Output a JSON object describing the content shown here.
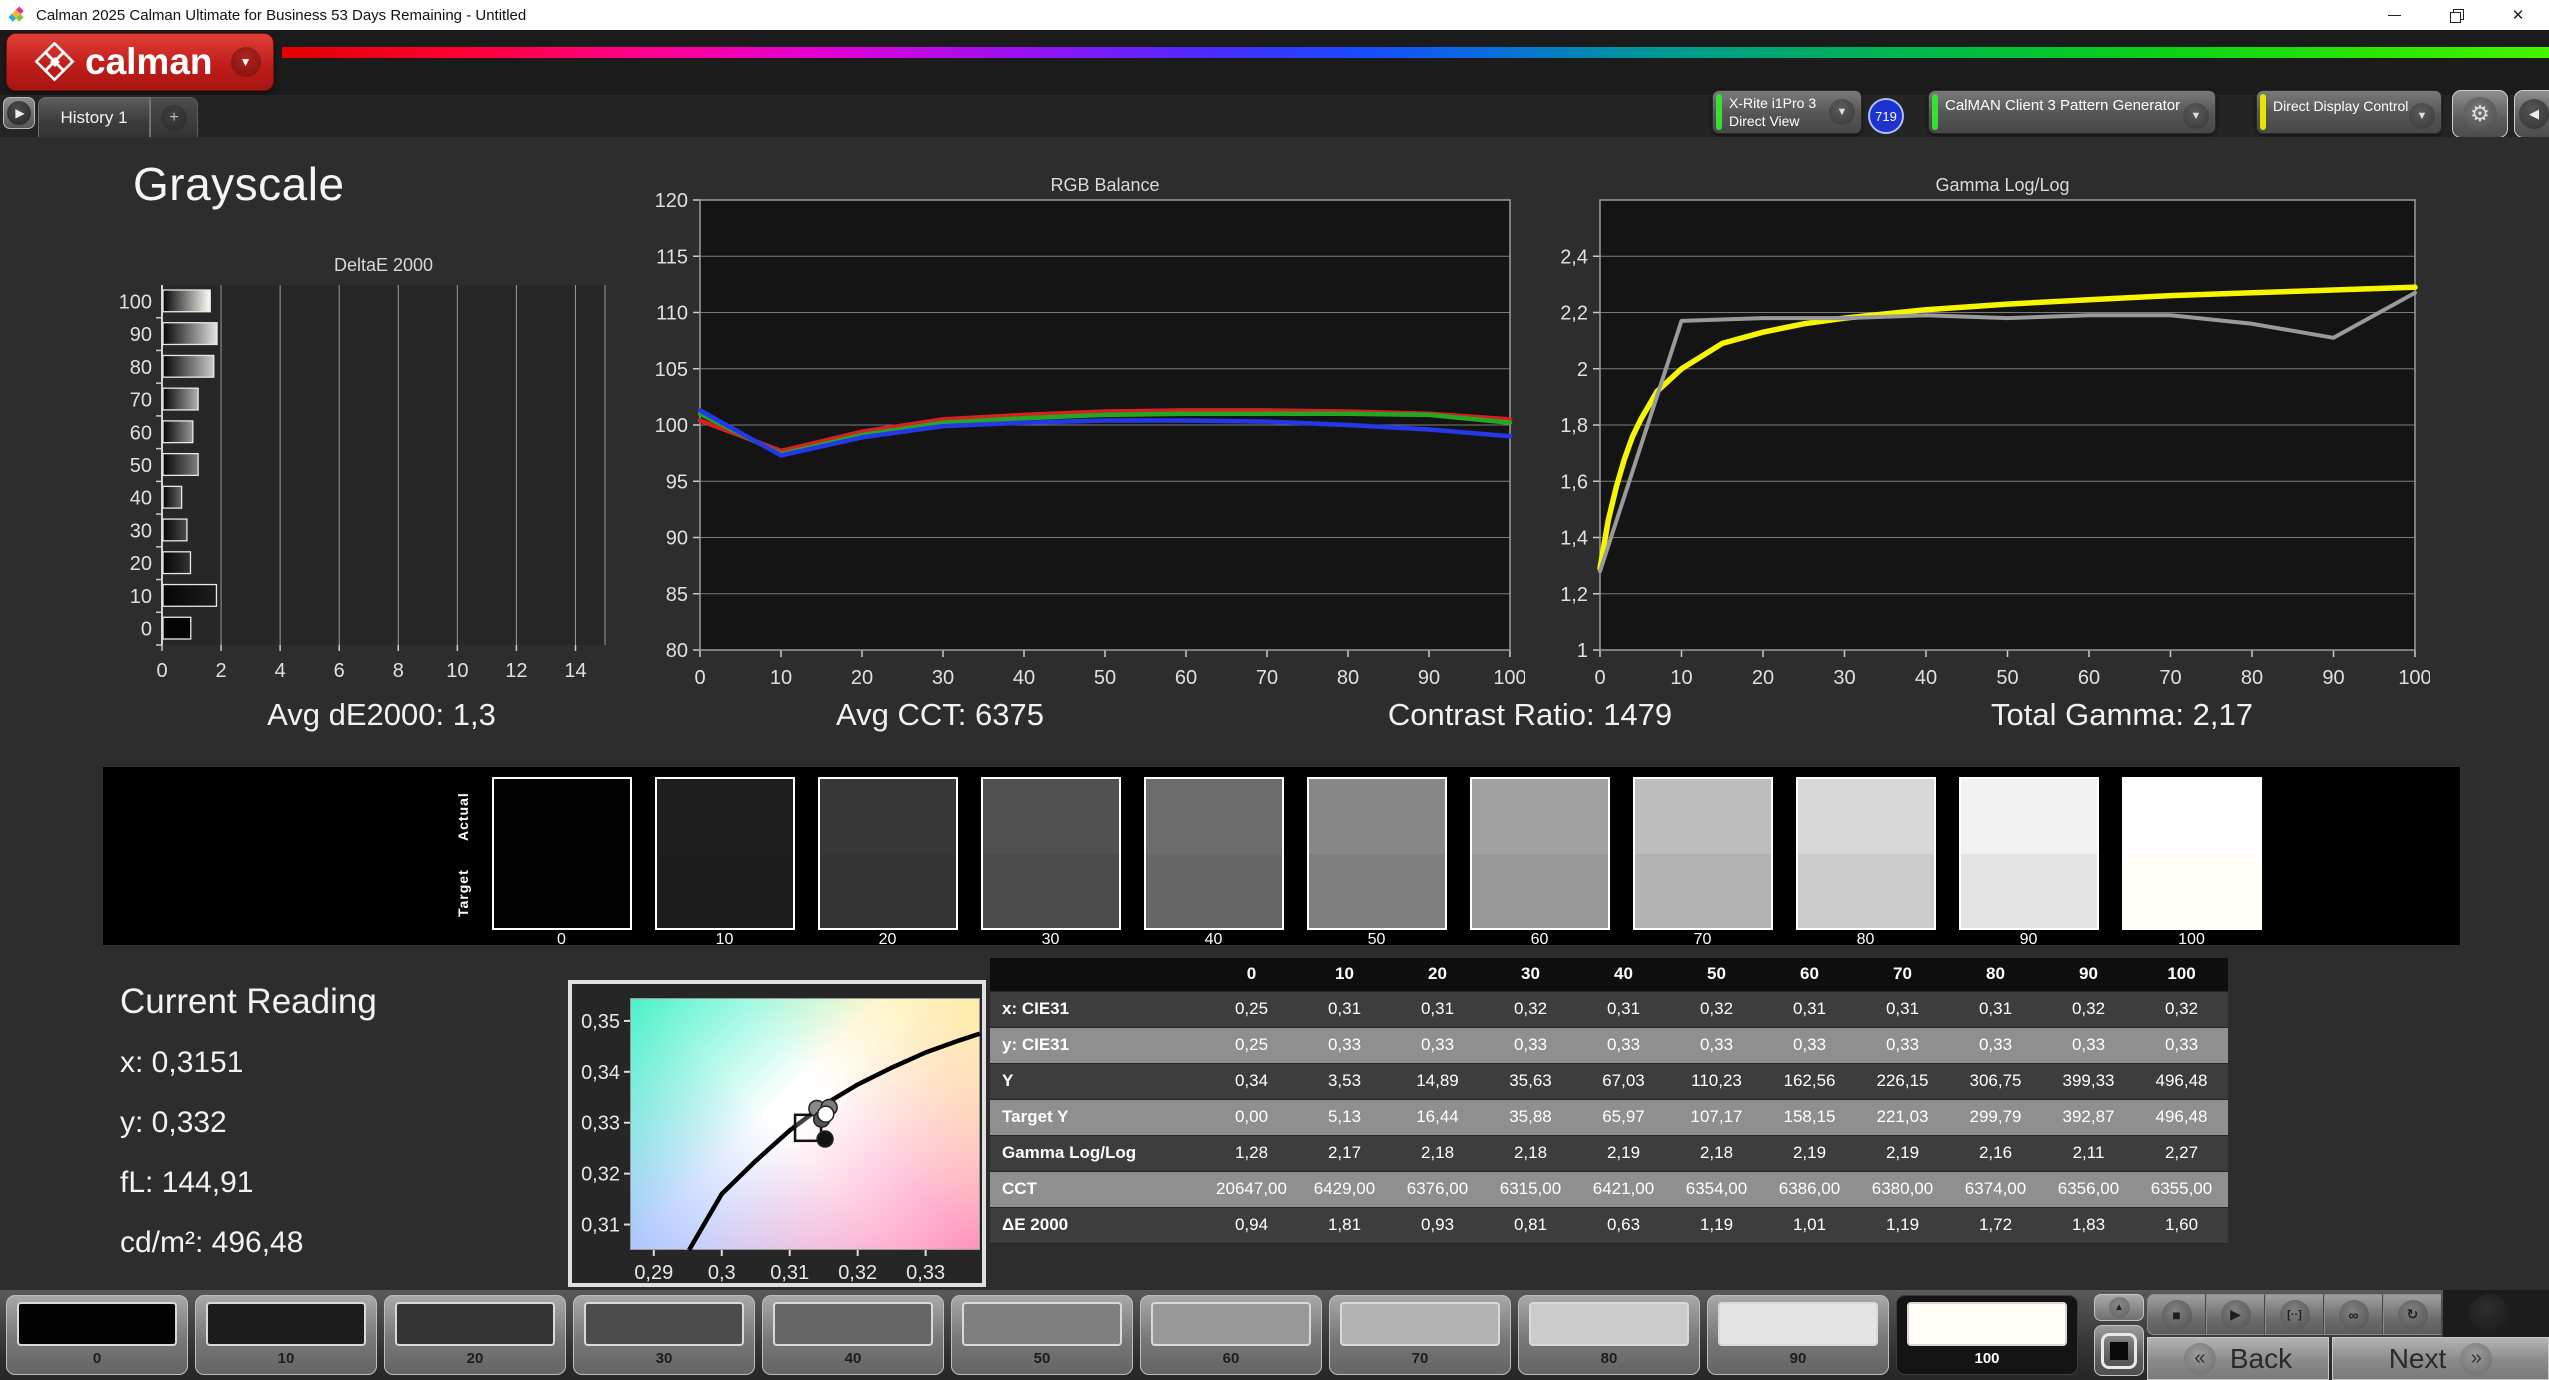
{
  "window": {
    "title": "Calman 2025 Calman Ultimate for Business 53 Days Remaining  - Untitled",
    "controls": [
      "minimize",
      "restore",
      "close"
    ]
  },
  "header": {
    "logo_text": "calman"
  },
  "tabs": {
    "history_label": "History 1",
    "add_label": "+"
  },
  "toolbar": {
    "meter": {
      "line1": "X-Rite i1Pro 3",
      "line2": "Direct View",
      "accent": "#35e035",
      "badge": "719"
    },
    "pattern_generator": {
      "label": "CalMAN Client 3 Pattern Generator",
      "accent": "#35e035"
    },
    "display_control": {
      "label": "Direct Display Control",
      "accent": "#e8e400"
    }
  },
  "page": {
    "title": "Grayscale"
  },
  "summary": {
    "avg_de": "Avg dE2000: 1,3",
    "avg_cct": "Avg CCT: 6375",
    "contrast": "Contrast Ratio: 1479",
    "total_gamma": "Total Gamma: 2,17"
  },
  "swatch_strip": {
    "actual_label": "Actual",
    "target_label": "Target",
    "levels": [
      "0",
      "10",
      "20",
      "30",
      "40",
      "50",
      "60",
      "70",
      "80",
      "90",
      "100"
    ],
    "colors": [
      "#020202",
      "#1c1c1c",
      "#343434",
      "#4c4c4c",
      "#666666",
      "#7f7f7f",
      "#989898",
      "#b2b2b2",
      "#cbcbcb",
      "#e4e4e4",
      "#fffdf6"
    ]
  },
  "current_reading": {
    "title": "Current Reading",
    "x": "x: 0,3151",
    "y": "y: 0,332",
    "fl": "fL: 144,91",
    "cdm2": "cd/m²: 496,48"
  },
  "chart_data": [
    {
      "type": "bar",
      "title": "DeltaE 2000",
      "orientation": "horizontal",
      "categories": [
        "0",
        "10",
        "20",
        "30",
        "40",
        "50",
        "60",
        "70",
        "80",
        "90",
        "100"
      ],
      "values": [
        0.94,
        1.81,
        0.93,
        0.81,
        0.63,
        1.19,
        1.01,
        1.19,
        1.72,
        1.83,
        1.6
      ],
      "xlabel": "",
      "ylabel": "",
      "xlim": [
        0,
        15
      ],
      "xticks": [
        0,
        2,
        4,
        6,
        8,
        10,
        12,
        14
      ],
      "grid": true
    },
    {
      "type": "line",
      "title": "RGB Balance",
      "x": [
        0,
        10,
        20,
        30,
        40,
        50,
        60,
        70,
        80,
        90,
        100
      ],
      "ylim": [
        80,
        120
      ],
      "yticks": [
        {
          "v": 120,
          "l": "120"
        },
        {
          "v": 115,
          "l": "115"
        },
        {
          "v": 110,
          "l": "110"
        },
        {
          "v": 105,
          "l": "105"
        },
        {
          "v": 100,
          "l": "100"
        },
        {
          "v": 95,
          "l": "95"
        },
        {
          "v": 90,
          "l": "90"
        },
        {
          "v": 85,
          "l": "85"
        },
        {
          "v": 80,
          "l": "80"
        }
      ],
      "xticks": [
        {
          "v": 0,
          "l": "0"
        },
        {
          "v": 10,
          "l": "10"
        },
        {
          "v": 20,
          "l": "20"
        },
        {
          "v": 30,
          "l": "30"
        },
        {
          "v": 40,
          "l": "40"
        },
        {
          "v": 50,
          "l": "50"
        },
        {
          "v": 60,
          "l": "60"
        },
        {
          "v": 70,
          "l": "70"
        },
        {
          "v": 80,
          "l": "80"
        },
        {
          "v": 90,
          "l": "90"
        },
        {
          "v": 100,
          "l": "100"
        }
      ],
      "grid": true,
      "series": [
        {
          "name": "Red",
          "color": "#d42222",
          "values": [
            100.4,
            97.7,
            99.4,
            100.5,
            100.9,
            101.2,
            101.3,
            101.3,
            101.2,
            101.0,
            100.5
          ]
        },
        {
          "name": "Green",
          "color": "#22a822",
          "values": [
            101.0,
            97.4,
            99.1,
            100.2,
            100.6,
            100.9,
            101.0,
            101.0,
            101.0,
            100.9,
            100.2
          ]
        },
        {
          "name": "Blue",
          "color": "#2438e8",
          "values": [
            101.3,
            97.3,
            98.9,
            99.9,
            100.2,
            100.4,
            100.4,
            100.3,
            100.0,
            99.6,
            99.0
          ]
        }
      ]
    },
    {
      "type": "line",
      "title": "Gamma Log/Log",
      "ylim": [
        1.0,
        2.6
      ],
      "yticks": [
        {
          "v": 2.4,
          "l": "2,4"
        },
        {
          "v": 2.2,
          "l": "2,2"
        },
        {
          "v": 2.0,
          "l": "2"
        },
        {
          "v": 1.8,
          "l": "1,8"
        },
        {
          "v": 1.6,
          "l": "1,6"
        },
        {
          "v": 1.4,
          "l": "1,4"
        },
        {
          "v": 1.2,
          "l": "1,2"
        },
        {
          "v": 1.0,
          "l": "1"
        }
      ],
      "xticks": [
        {
          "v": 0,
          "l": "0"
        },
        {
          "v": 10,
          "l": "10"
        },
        {
          "v": 20,
          "l": "20"
        },
        {
          "v": 30,
          "l": "30"
        },
        {
          "v": 40,
          "l": "40"
        },
        {
          "v": 50,
          "l": "50"
        },
        {
          "v": 60,
          "l": "60"
        },
        {
          "v": 70,
          "l": "70"
        },
        {
          "v": 80,
          "l": "80"
        },
        {
          "v": 90,
          "l": "90"
        },
        {
          "v": 100,
          "l": "100"
        }
      ],
      "grid": true,
      "series": [
        {
          "name": "Target Gamma",
          "color": "#f6f600",
          "width": 5.5,
          "x": [
            0,
            1,
            2,
            3,
            4,
            5,
            7,
            10,
            15,
            20,
            25,
            30,
            40,
            50,
            60,
            70,
            80,
            90,
            100
          ],
          "values": [
            1.29,
            1.46,
            1.58,
            1.68,
            1.76,
            1.82,
            1.92,
            2.0,
            2.09,
            2.13,
            2.16,
            2.18,
            2.21,
            2.23,
            2.245,
            2.26,
            2.27,
            2.28,
            2.29
          ]
        },
        {
          "name": "Measured Gamma",
          "color": "#9a9a9a",
          "width": 4,
          "x": [
            0,
            10,
            20,
            30,
            40,
            50,
            60,
            70,
            80,
            90,
            100
          ],
          "values": [
            1.28,
            2.17,
            2.18,
            2.18,
            2.19,
            2.18,
            2.19,
            2.19,
            2.16,
            2.11,
            2.27
          ]
        }
      ]
    },
    {
      "type": "scatter",
      "title": "CIE xy white point",
      "xlim": [
        0.2865,
        0.338
      ],
      "ylim": [
        0.305,
        0.3545
      ],
      "xticks": [
        {
          "v": 0.29,
          "l": "0,29"
        },
        {
          "v": 0.3,
          "l": "0,3"
        },
        {
          "v": 0.31,
          "l": "0,31"
        },
        {
          "v": 0.32,
          "l": "0,32"
        },
        {
          "v": 0.33,
          "l": "0,33"
        }
      ],
      "yticks": [
        {
          "v": 0.35,
          "l": "0,35"
        },
        {
          "v": 0.34,
          "l": "0,34"
        },
        {
          "v": 0.33,
          "l": "0,33"
        },
        {
          "v": 0.32,
          "l": "0,32"
        },
        {
          "v": 0.31,
          "l": "0,31"
        }
      ],
      "locus": [
        [
          0.2952,
          0.305
        ],
        [
          0.3,
          0.316
        ],
        [
          0.305,
          0.3225
        ],
        [
          0.31,
          0.3285
        ],
        [
          0.315,
          0.3335
        ],
        [
          0.32,
          0.3375
        ],
        [
          0.325,
          0.3408
        ],
        [
          0.33,
          0.3438
        ],
        [
          0.335,
          0.3462
        ],
        [
          0.338,
          0.3475
        ]
      ],
      "target_square": {
        "x": 0.3127,
        "y": 0.329
      },
      "points": [
        {
          "x": 0.314,
          "y": 0.3328,
          "color": "#8a8a8a"
        },
        {
          "x": 0.3158,
          "y": 0.333,
          "color": "#7a7a7a"
        },
        {
          "x": 0.3147,
          "y": 0.3307,
          "color": "#555555"
        },
        {
          "x": 0.3153,
          "y": 0.3317,
          "color": "#ffffff"
        },
        {
          "x": 0.3152,
          "y": 0.3268,
          "color": "#111111"
        }
      ]
    }
  ],
  "table": {
    "columns": [
      "0",
      "10",
      "20",
      "30",
      "40",
      "50",
      "60",
      "70",
      "80",
      "90",
      "100"
    ],
    "rows": [
      {
        "label": "x: CIE31",
        "shade": "dark",
        "values": [
          "0,25",
          "0,31",
          "0,31",
          "0,32",
          "0,31",
          "0,32",
          "0,31",
          "0,31",
          "0,31",
          "0,32",
          "0,32"
        ]
      },
      {
        "label": "y: CIE31",
        "shade": "light",
        "values": [
          "0,25",
          "0,33",
          "0,33",
          "0,33",
          "0,33",
          "0,33",
          "0,33",
          "0,33",
          "0,33",
          "0,33",
          "0,33"
        ]
      },
      {
        "label": "Y",
        "shade": "dark",
        "values": [
          "0,34",
          "3,53",
          "14,89",
          "35,63",
          "67,03",
          "110,23",
          "162,56",
          "226,15",
          "306,75",
          "399,33",
          "496,48"
        ]
      },
      {
        "label": "Target Y",
        "shade": "light",
        "values": [
          "0,00",
          "5,13",
          "16,44",
          "35,88",
          "65,97",
          "107,17",
          "158,15",
          "221,03",
          "299,79",
          "392,87",
          "496,48"
        ]
      },
      {
        "label": "Gamma Log/Log",
        "shade": "dark",
        "values": [
          "1,28",
          "2,17",
          "2,18",
          "2,18",
          "2,19",
          "2,18",
          "2,19",
          "2,19",
          "2,16",
          "2,11",
          "2,27"
        ]
      },
      {
        "label": "CCT",
        "shade": "light",
        "values": [
          "20647,00",
          "6429,00",
          "6376,00",
          "6315,00",
          "6421,00",
          "6354,00",
          "6386,00",
          "6380,00",
          "6374,00",
          "6356,00",
          "6355,00"
        ]
      },
      {
        "label": "ΔE 2000",
        "shade": "dark",
        "values": [
          "0,94",
          "1,81",
          "0,93",
          "0,81",
          "0,63",
          "1,19",
          "1,01",
          "1,19",
          "1,72",
          "1,83",
          "1,60"
        ]
      }
    ]
  },
  "bottom_bar": {
    "levels": [
      "0",
      "10",
      "20",
      "30",
      "40",
      "50",
      "60",
      "70",
      "80",
      "90",
      "100"
    ],
    "colors": [
      "#020202",
      "#1c1c1c",
      "#343434",
      "#4c4c4c",
      "#666666",
      "#7f7f7f",
      "#989898",
      "#b2b2b2",
      "#cbcbcb",
      "#e4e4e4",
      "#fffdf6"
    ],
    "selected": "100",
    "transport_icons": [
      {
        "name": "stop-icon",
        "glyph": "■"
      },
      {
        "name": "play-icon",
        "glyph": "▶"
      },
      {
        "name": "step-measure-icon",
        "glyph": "[··]"
      },
      {
        "name": "continuous-icon",
        "glyph": "∞"
      },
      {
        "name": "refresh-icon",
        "glyph": "↻"
      }
    ],
    "back_label": "Back",
    "next_label": "Next"
  }
}
